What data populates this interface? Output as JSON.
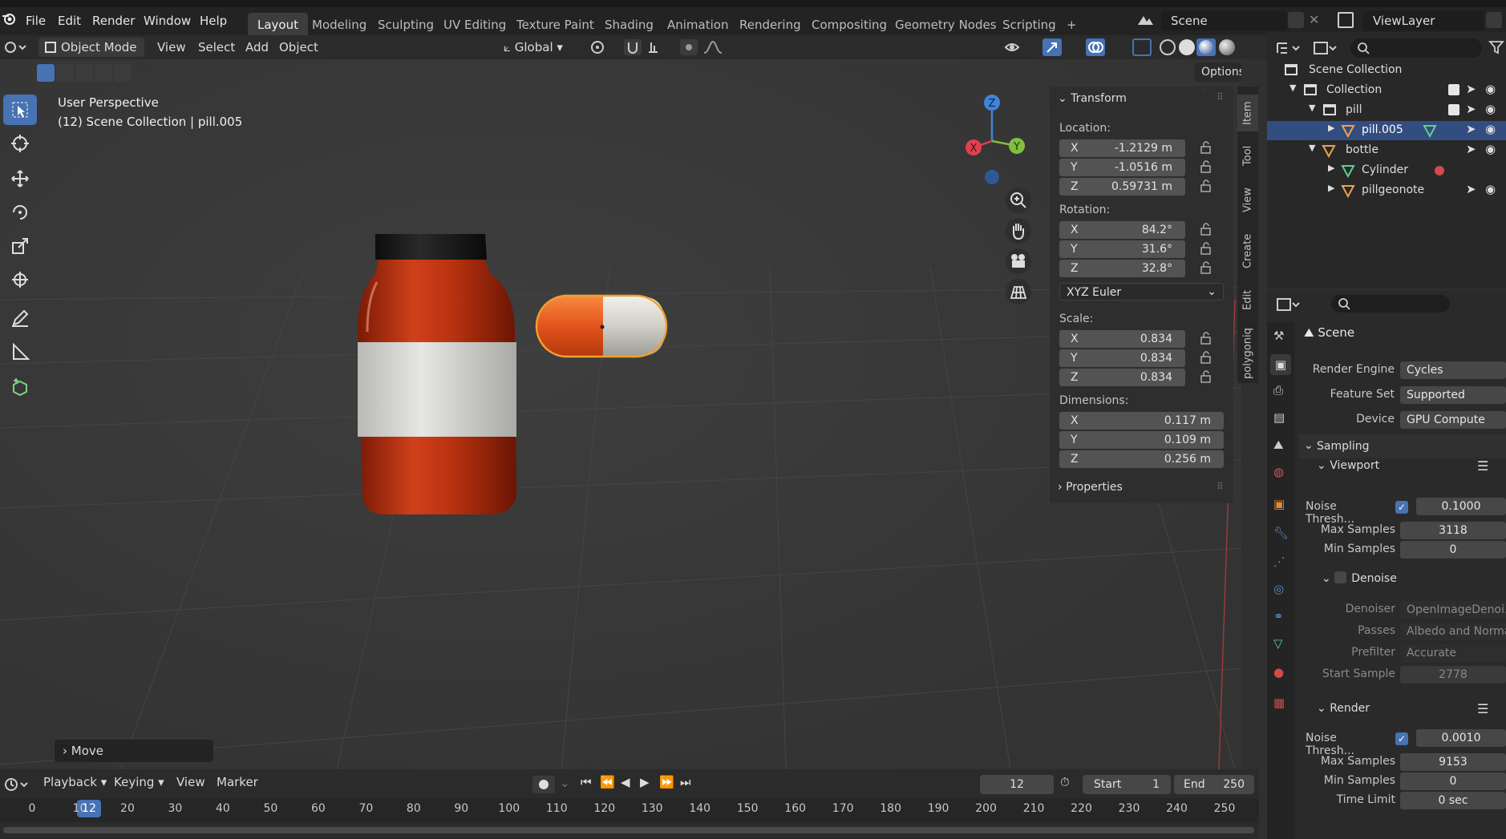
{
  "topbar": {
    "menus": [
      "File",
      "Edit",
      "Render",
      "Window",
      "Help"
    ],
    "workspaces": [
      "Layout",
      "Modeling",
      "Sculpting",
      "UV Editing",
      "Texture Paint",
      "Shading",
      "Animation",
      "Rendering",
      "Compositing",
      "Geometry Nodes",
      "Scripting"
    ],
    "active_workspace": "Layout",
    "add_tab": "+",
    "scene": "Scene",
    "view_layer": "ViewLayer"
  },
  "header": {
    "mode": "Object Mode",
    "menus": [
      "View",
      "Select",
      "Add",
      "Object"
    ],
    "transform_orientation": "Global",
    "options": "Options"
  },
  "viewport": {
    "info_line1": "User Perspective",
    "info_line2": "(12) Scene Collection | pill.005",
    "last_op": "Move",
    "gizmo_axes": [
      "X",
      "Y",
      "Z"
    ]
  },
  "npanel": {
    "transform_title": "Transform",
    "location_label": "Location:",
    "location": {
      "x": "-1.2129 m",
      "y": "-1.0516 m",
      "z": "0.59731 m"
    },
    "rotation_label": "Rotation:",
    "rotation": {
      "x": "84.2°",
      "y": "31.6°",
      "z": "32.8°"
    },
    "rotation_mode": "XYZ Euler",
    "scale_label": "Scale:",
    "scale": {
      "x": "0.834",
      "y": "0.834",
      "z": "0.834"
    },
    "dimensions_label": "Dimensions:",
    "dimensions": {
      "x": "0.117 m",
      "y": "0.109 m",
      "z": "0.256 m"
    },
    "axis_x": "X",
    "axis_y": "Y",
    "axis_z": "Z",
    "properties_title": "Properties",
    "tabs": [
      "Item",
      "Tool",
      "View",
      "Create",
      "Edit",
      "polygoniq"
    ]
  },
  "outliner": {
    "rows": [
      {
        "label": "Scene Collection"
      },
      {
        "label": "Collection"
      },
      {
        "label": "pill"
      },
      {
        "label": "pill.005"
      },
      {
        "label": "bottle"
      },
      {
        "label": "Cylinder"
      },
      {
        "label": "pillgeonote"
      }
    ]
  },
  "properties": {
    "context": "Scene",
    "render_engine_label": "Render Engine",
    "render_engine": "Cycles",
    "feature_set_label": "Feature Set",
    "feature_set": "Supported",
    "device_label": "Device",
    "device": "GPU Compute",
    "sampling": "Sampling",
    "viewport": "Viewport",
    "noise_thresh_label": "Noise Thresh...",
    "vp_noise": "0.1000",
    "max_samples_label": "Max Samples",
    "vp_max": "3118",
    "min_samples_label": "Min Samples",
    "vp_min": "0",
    "denoise": "Denoise",
    "denoiser_label": "Denoiser",
    "denoiser": "OpenImageDenoi...",
    "passes_label": "Passes",
    "passes": "Albedo and Normal",
    "prefilter_label": "Prefilter",
    "prefilter": "Accurate",
    "start_sample_label": "Start Sample",
    "start_sample": "2778",
    "render": "Render",
    "r_noise": "0.0010",
    "r_max": "9153",
    "r_min": "0",
    "time_limit_label": "Time Limit",
    "time_limit": "0 sec"
  },
  "timeline": {
    "menus": [
      "Playback",
      "Keying",
      "View",
      "Marker"
    ],
    "current_frame": "12",
    "start_label": "Start",
    "start": "1",
    "end_label": "End",
    "end": "250",
    "ticks": [
      "0",
      "10",
      "20",
      "30",
      "40",
      "50",
      "60",
      "70",
      "80",
      "90",
      "100",
      "110",
      "120",
      "130",
      "140",
      "150",
      "160",
      "170",
      "180",
      "190",
      "200",
      "210",
      "220",
      "230",
      "240",
      "250"
    ],
    "playhead": "12"
  },
  "colors": {
    "accent": "#4772b3",
    "x_axis": "#e04050",
    "y_axis": "#7fbf3f",
    "z_axis": "#3f84d9",
    "bottle": "#b83210",
    "pill_orange": "#e0501a",
    "pill_white": "#d8d8d0"
  }
}
